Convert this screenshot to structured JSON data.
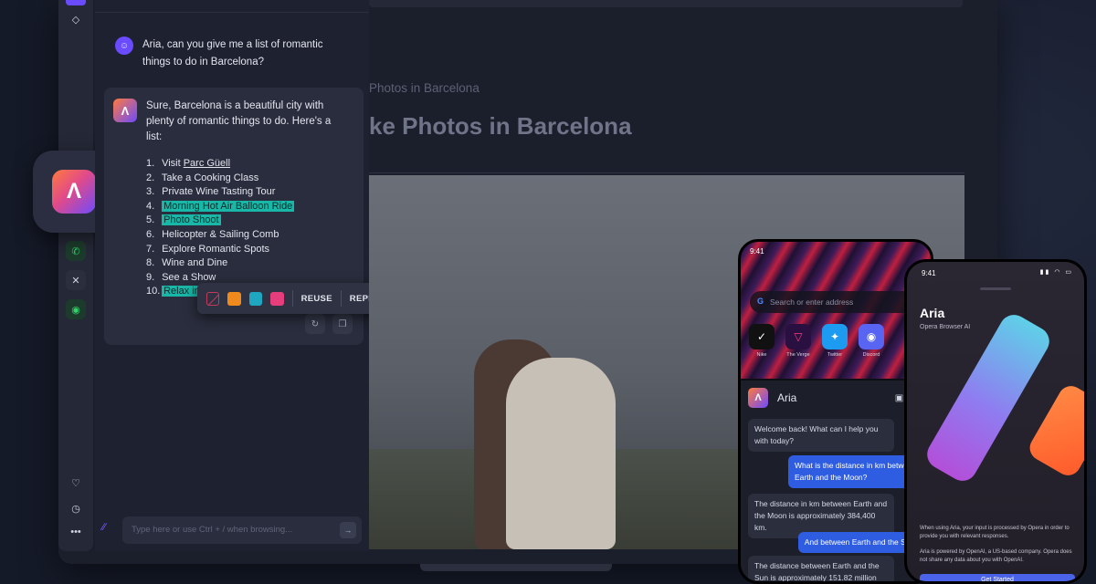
{
  "chat": {
    "user_message": "Aria, can you give me a list of romantic things to do in Barcelona?",
    "ai_intro": "Sure, Barcelona is a beautiful city with plenty of romantic things to do. Here's a list:",
    "list": [
      {
        "num": "1.",
        "pre": "Visit ",
        "text": "Parc Güell"
      },
      {
        "num": "2.",
        "text": "Take a Cooking Class"
      },
      {
        "num": "3.",
        "text": "Private Wine Tasting Tour"
      },
      {
        "num": "4.",
        "text": "Morning Hot Air Balloon Ride"
      },
      {
        "num": "5.",
        "text": "Photo Shoot"
      },
      {
        "num": "6.",
        "text": "Helicopter & Sailing Comb"
      },
      {
        "num": "7.",
        "text": "Explore Romantic Spots"
      },
      {
        "num": "8.",
        "text": "Wine and Dine"
      },
      {
        "num": "9.",
        "text": "See a Show"
      },
      {
        "num": "10.",
        "text": "Relax in"
      }
    ],
    "popup": {
      "reuse": "REUSE",
      "rephrase": "REPHRASE",
      "swatches": [
        "#f08a1c",
        "#1fa7c2",
        "#e63d7c"
      ]
    },
    "input_placeholder": "Type here or use Ctrl + / when browsing..."
  },
  "webpage": {
    "breadcrumb": "Photos in Barcelona",
    "headline": "ke Photos in Barcelona"
  },
  "phone1": {
    "time": "9:41",
    "search_placeholder": "Search or enter address",
    "speed_dials": [
      {
        "label": "Nike",
        "icon": "nike-icon",
        "color": "#111111"
      },
      {
        "label": "The Verge",
        "icon": "verge-icon",
        "color": "#2a1040"
      },
      {
        "label": "Twitter",
        "icon": "twitter-icon",
        "color": "#1d9bf0"
      },
      {
        "label": "Discord",
        "icon": "discord-icon",
        "color": "#5865f2"
      }
    ],
    "aria_title": "Aria",
    "messages": [
      {
        "type": "in",
        "text": "Welcome back! What can I help you with today?"
      },
      {
        "type": "out",
        "text": "What is the distance in km between Earth and the Moon?"
      },
      {
        "type": "in",
        "text": "The distance in km between Earth and the Moon is approximately 384,400 km."
      },
      {
        "type": "out",
        "text": "And between Earth and the Sun?"
      },
      {
        "type": "in",
        "text": "The distance between Earth and the Sun is approximately 151.82 million"
      }
    ]
  },
  "phone2": {
    "time": "9:41",
    "title": "Aria",
    "subtitle": "Opera Browser AI",
    "note1": "When using Aria, your input is processed by Opera in order to provide you with relevant responses.",
    "note2": "Aria is powered by OpenAI, a US-based company. Opera does not share any data about you with OpenAI.",
    "button": "Get Started"
  }
}
